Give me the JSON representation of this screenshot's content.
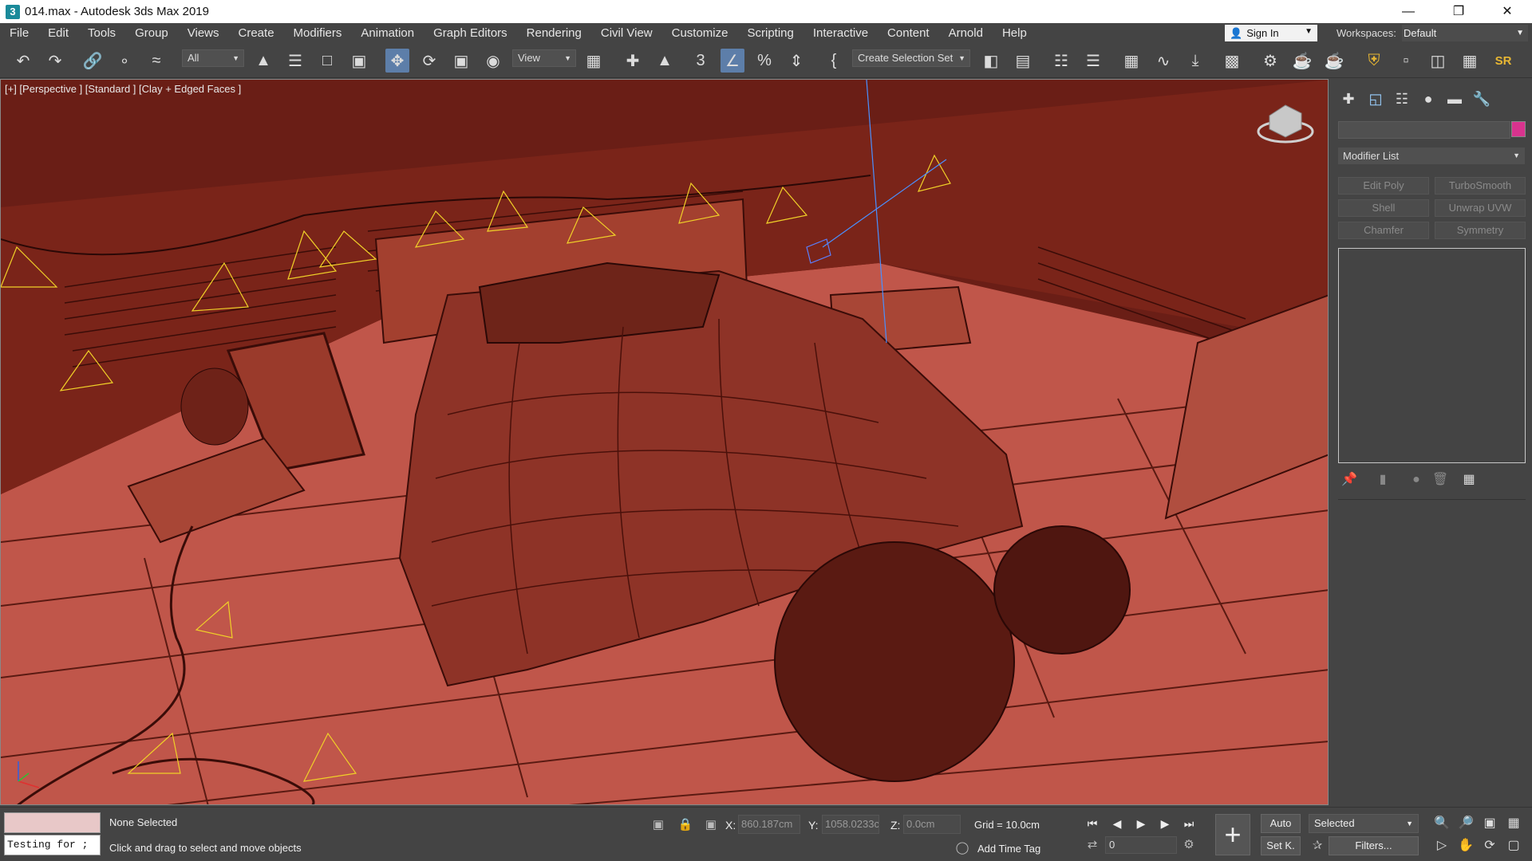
{
  "window": {
    "app_icon": "3",
    "title": "014.max - Autodesk 3ds Max 2019",
    "minimize": "—",
    "maximize": "❐",
    "close": "✕"
  },
  "menu": {
    "items": [
      "File",
      "Edit",
      "Tools",
      "Group",
      "Views",
      "Create",
      "Modifiers",
      "Animation",
      "Graph Editors",
      "Rendering",
      "Civil View",
      "Customize",
      "Scripting",
      "Interactive",
      "Content",
      "Arnold",
      "Help"
    ],
    "sign_in": "Sign In",
    "workspaces_label": "Workspaces:",
    "workspace_value": "Default"
  },
  "toolbar": {
    "selection_filter": "All",
    "ref_coord_system": "View",
    "named_selection_set": "Create Selection Set",
    "sr_label": "SR"
  },
  "viewport": {
    "label": "[+] [Perspective ] [Standard ] [Clay + Edged Faces ]",
    "background_color": "#6a1e16",
    "floor_color": "#c0564a",
    "wire_color": "#3a0c08",
    "light_helper_color": "#f0d028"
  },
  "command_panel": {
    "modifier_list_label": "Modifier List",
    "object_color": "#d9338e",
    "modifier_buttons": [
      "Edit Poly",
      "TurboSmooth",
      "Shell",
      "Unwrap UVW",
      "Chamfer",
      "Symmetry"
    ]
  },
  "status": {
    "maxscript_text": "Testing for ;",
    "selection": "None Selected",
    "prompt": "Click and drag to select and move objects",
    "x_label": "X:",
    "x_value": "860.187cm",
    "y_label": "Y:",
    "y_value": "1058.0233c",
    "z_label": "Z:",
    "z_value": "0.0cm",
    "grid": "Grid = 10.0cm",
    "add_time_tag": "Add Time Tag",
    "current_frame": "0",
    "auto_key": "Auto",
    "set_key": "Set K.",
    "key_filter_select": "Selected",
    "filters": "Filters..."
  }
}
